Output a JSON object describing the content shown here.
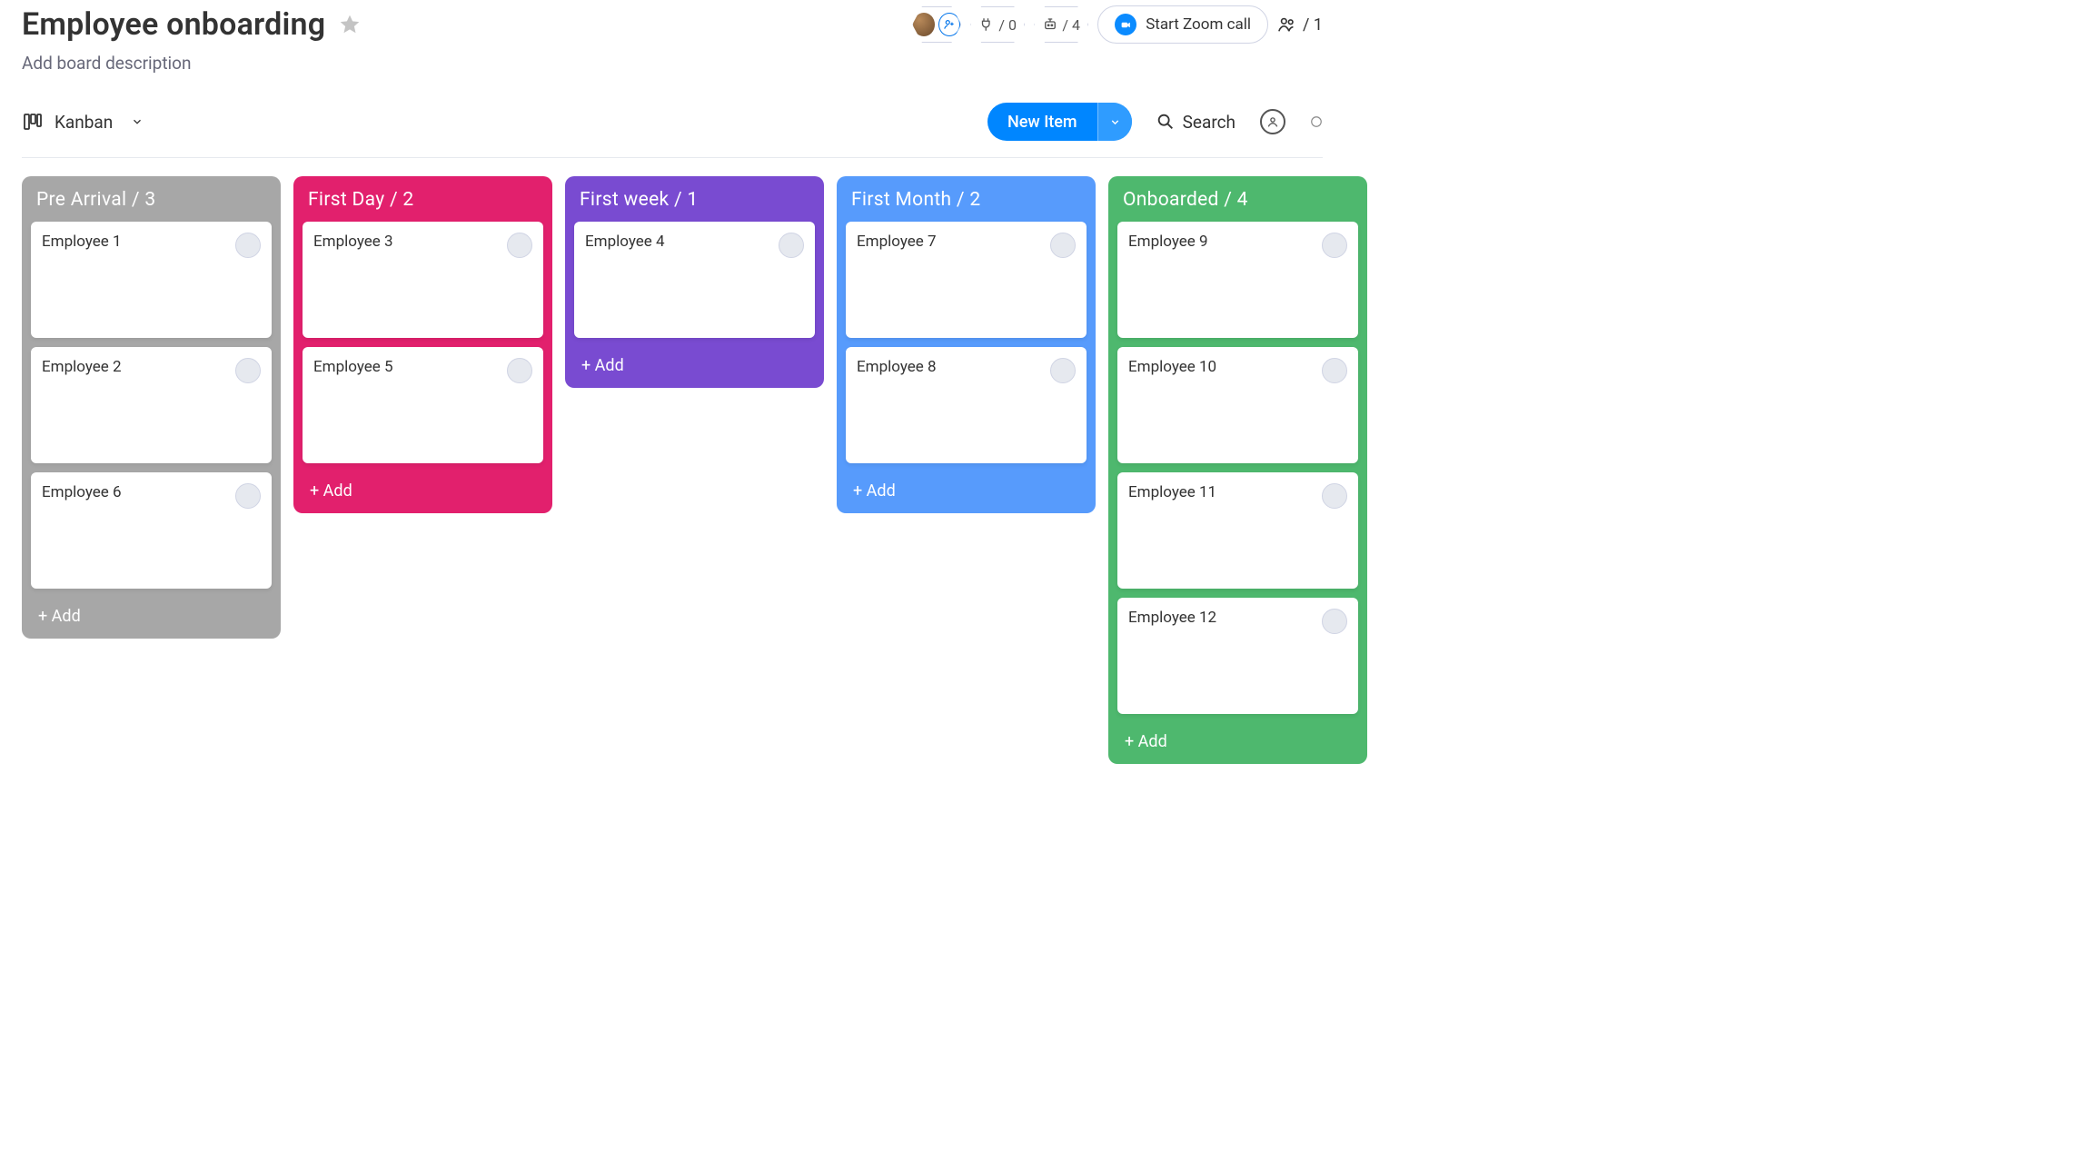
{
  "header": {
    "title": "Employee onboarding",
    "description": "Add board description",
    "integrations_count": "/ 0",
    "automations_count": "/ 4",
    "zoom_label": "Start Zoom call",
    "invite_count": "/ 1"
  },
  "toolbar": {
    "view_label": "Kanban",
    "new_item_label": "New Item",
    "search_label": "Search"
  },
  "columns": [
    {
      "title": "Pre Arrival",
      "count": 3,
      "color": "col-grey",
      "add_label": "+ Add",
      "cards": [
        "Employee 1",
        "Employee 2",
        "Employee 6"
      ]
    },
    {
      "title": "First Day",
      "count": 2,
      "color": "col-pink",
      "add_label": "+ Add",
      "cards": [
        "Employee 3",
        "Employee 5"
      ]
    },
    {
      "title": "First week",
      "count": 1,
      "color": "col-purple",
      "add_label": "+ Add",
      "cards": [
        "Employee 4"
      ]
    },
    {
      "title": "First Month",
      "count": 2,
      "color": "col-blue",
      "add_label": "+ Add",
      "cards": [
        "Employee 7",
        "Employee 8"
      ]
    },
    {
      "title": "Onboarded",
      "count": 4,
      "color": "col-green",
      "add_label": "+ Add",
      "cards": [
        "Employee 9",
        "Employee 10",
        "Employee 11",
        "Employee 12"
      ]
    }
  ]
}
